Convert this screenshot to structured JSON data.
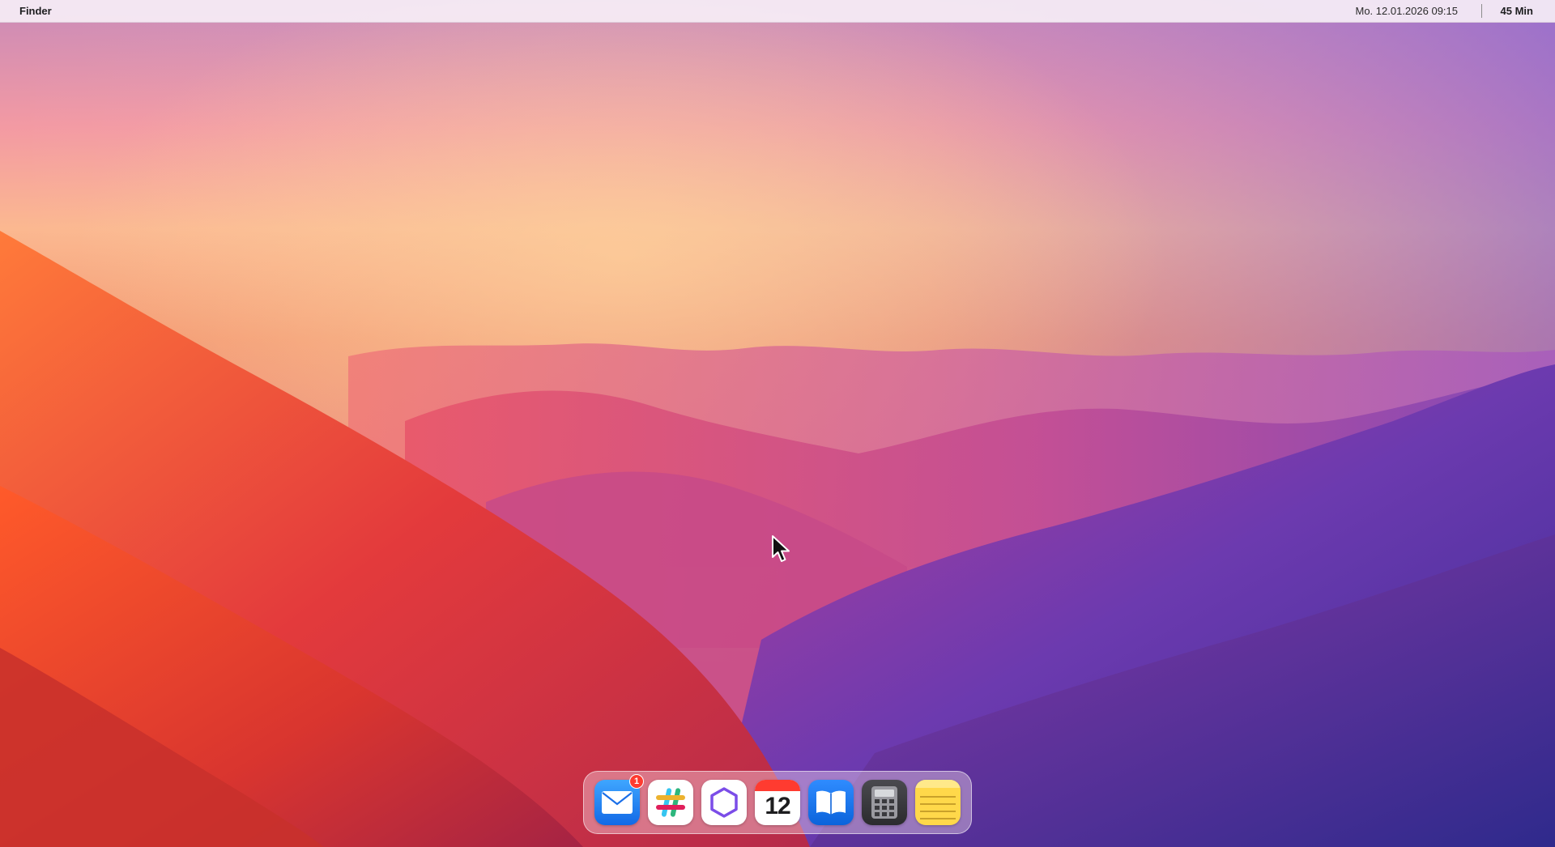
{
  "menubar": {
    "app_name": "Finder",
    "datetime": "Mo. 12.01.2026 09:15",
    "timer": "45 Min"
  },
  "dock": {
    "items": [
      {
        "name": "Mail",
        "icon": "mail-icon",
        "badge": "1"
      },
      {
        "name": "Slack",
        "icon": "slack-icon"
      },
      {
        "name": "Hexagon app",
        "icon": "hexagon-icon"
      },
      {
        "name": "Calendar",
        "icon": "calendar-icon",
        "day": "12"
      },
      {
        "name": "Books",
        "icon": "book-icon"
      },
      {
        "name": "Calculator",
        "icon": "calculator-icon"
      },
      {
        "name": "Notes",
        "icon": "notes-icon"
      }
    ]
  },
  "colors": {
    "sky_top": "#c98ab8",
    "sky_glow": "#fbb38e",
    "hills_red": "#d9352f",
    "hills_purple": "#4b2e9c",
    "badge_red": "#ff3b30"
  }
}
